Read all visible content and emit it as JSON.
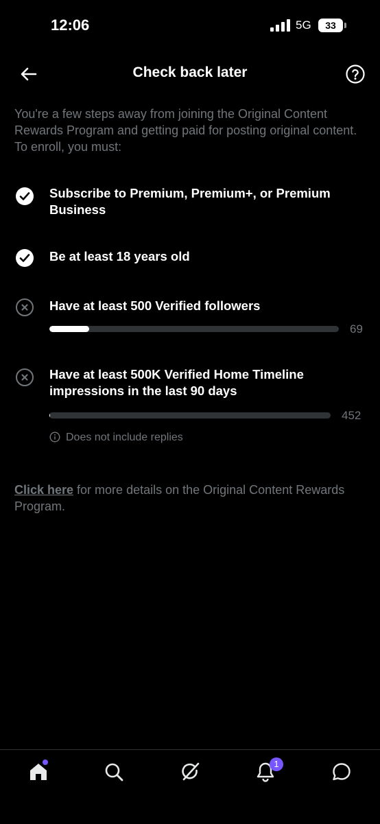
{
  "status_bar": {
    "time": "12:06",
    "network": "5G",
    "battery": "33"
  },
  "header": {
    "title": "Check back later"
  },
  "intro": "You're a few steps away from joining the Original Content Rewards Program and getting paid for posting original content. To enroll, you must:",
  "requirements": [
    {
      "label": "Subscribe to Premium, Premium+, or Premium Business",
      "status": "complete"
    },
    {
      "label": "Be at least 18 years old",
      "status": "complete"
    },
    {
      "label": "Have at least 500 Verified followers",
      "status": "incomplete",
      "current": "69",
      "progress": 0.138
    },
    {
      "label": "Have at least 500K Verified Home Timeline impressions in the last 90 days",
      "status": "incomplete",
      "current": "452",
      "progress": 0.0009,
      "note": "Does not include replies"
    }
  ],
  "footer": {
    "link_text": "Click here",
    "rest_text": " for more details on the Original Content Rewards Program."
  },
  "tabs": {
    "items": [
      "home-icon",
      "search-icon",
      "grok-icon",
      "notifications-icon",
      "messages-icon"
    ],
    "notification_count": "1"
  },
  "colors": {
    "background": "#000000",
    "text": "#e7e9ea",
    "muted": "#71767b",
    "accent": "#7856ff",
    "track": "#2f3336"
  }
}
